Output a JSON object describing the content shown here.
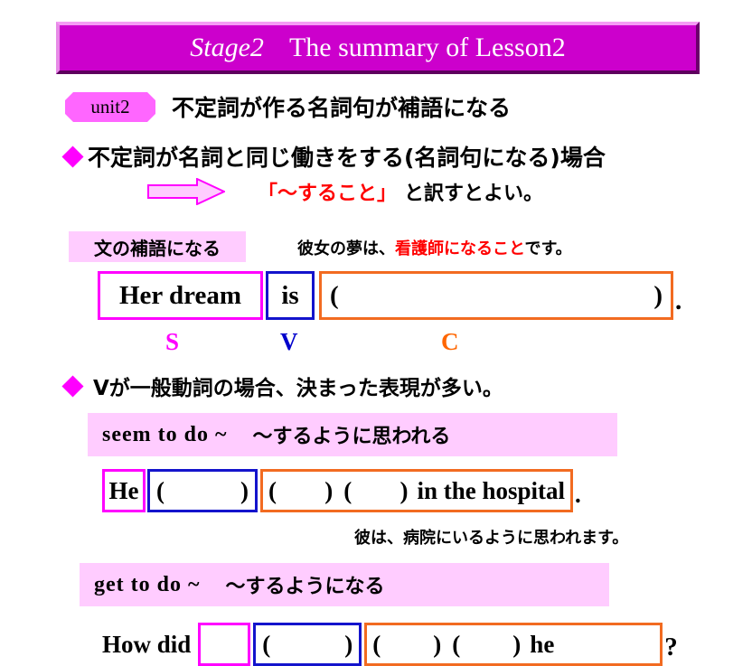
{
  "slide": {
    "title": {
      "stage": "Stage2",
      "main": "The summary of Lesson2"
    },
    "unit": {
      "badge": "unit2",
      "heading": "不定詞が作る名詞句が補語になる"
    },
    "bullets": [
      {
        "marker": "diamond",
        "text": "不定詞が名詞と同じ働きをする(名詞句になる)場合"
      },
      {
        "marker": "diamond",
        "text": "Vが一般動詞の場合、決まった表現が多い。"
      }
    ],
    "translation_hint": {
      "arrow": "block-arrow-right",
      "red_text": "「～すること」",
      "black_text": "と訳すとよい。"
    },
    "complement_section": {
      "label": "文の補語になる",
      "japanese_sentence": {
        "before": "彼女の夢は、",
        "highlight": "看護師になること",
        "after": "です。"
      },
      "sentence": {
        "subject": "Her dream",
        "verb": "is",
        "complement_open": "(",
        "complement_close": ")",
        "period": "."
      },
      "svc_labels": {
        "s": "S",
        "v": "V",
        "c": "C"
      }
    },
    "idioms": [
      {
        "english": "seem  to  do  ~",
        "japanese": "～するように思われる"
      },
      {
        "english": "get  to  do  ~",
        "japanese": "～するようになる"
      }
    ],
    "seem_example": {
      "subject": "He",
      "verb_open": "(",
      "verb_close": ")",
      "c_open1": "(",
      "c_close1": ")",
      "c_open2": "(",
      "c_close2": ")",
      "tail": "in the hospital",
      "period": ".",
      "japanese_translation": "彼は、病院にいるように思われます。"
    },
    "get_example": {
      "lead": "How did",
      "verb_open": "(",
      "verb_close": ")",
      "c_open1": "(",
      "c_close1": ")",
      "c_open2": "(",
      "c_close2": ")",
      "tail": "he",
      "question_mark": "?"
    },
    "colors": {
      "title_bg": "#CC00CC",
      "badge_bg": "#FF66FF",
      "highlight_pink": "#FFCCFF",
      "subject_box": "#FF00FF",
      "verb_box": "#1414CC",
      "complement_box": "#F26B21",
      "accent_red": "#FF0000",
      "s_label": "#FF00FF",
      "v_label": "#0000CC",
      "c_label": "#FF6600"
    }
  }
}
